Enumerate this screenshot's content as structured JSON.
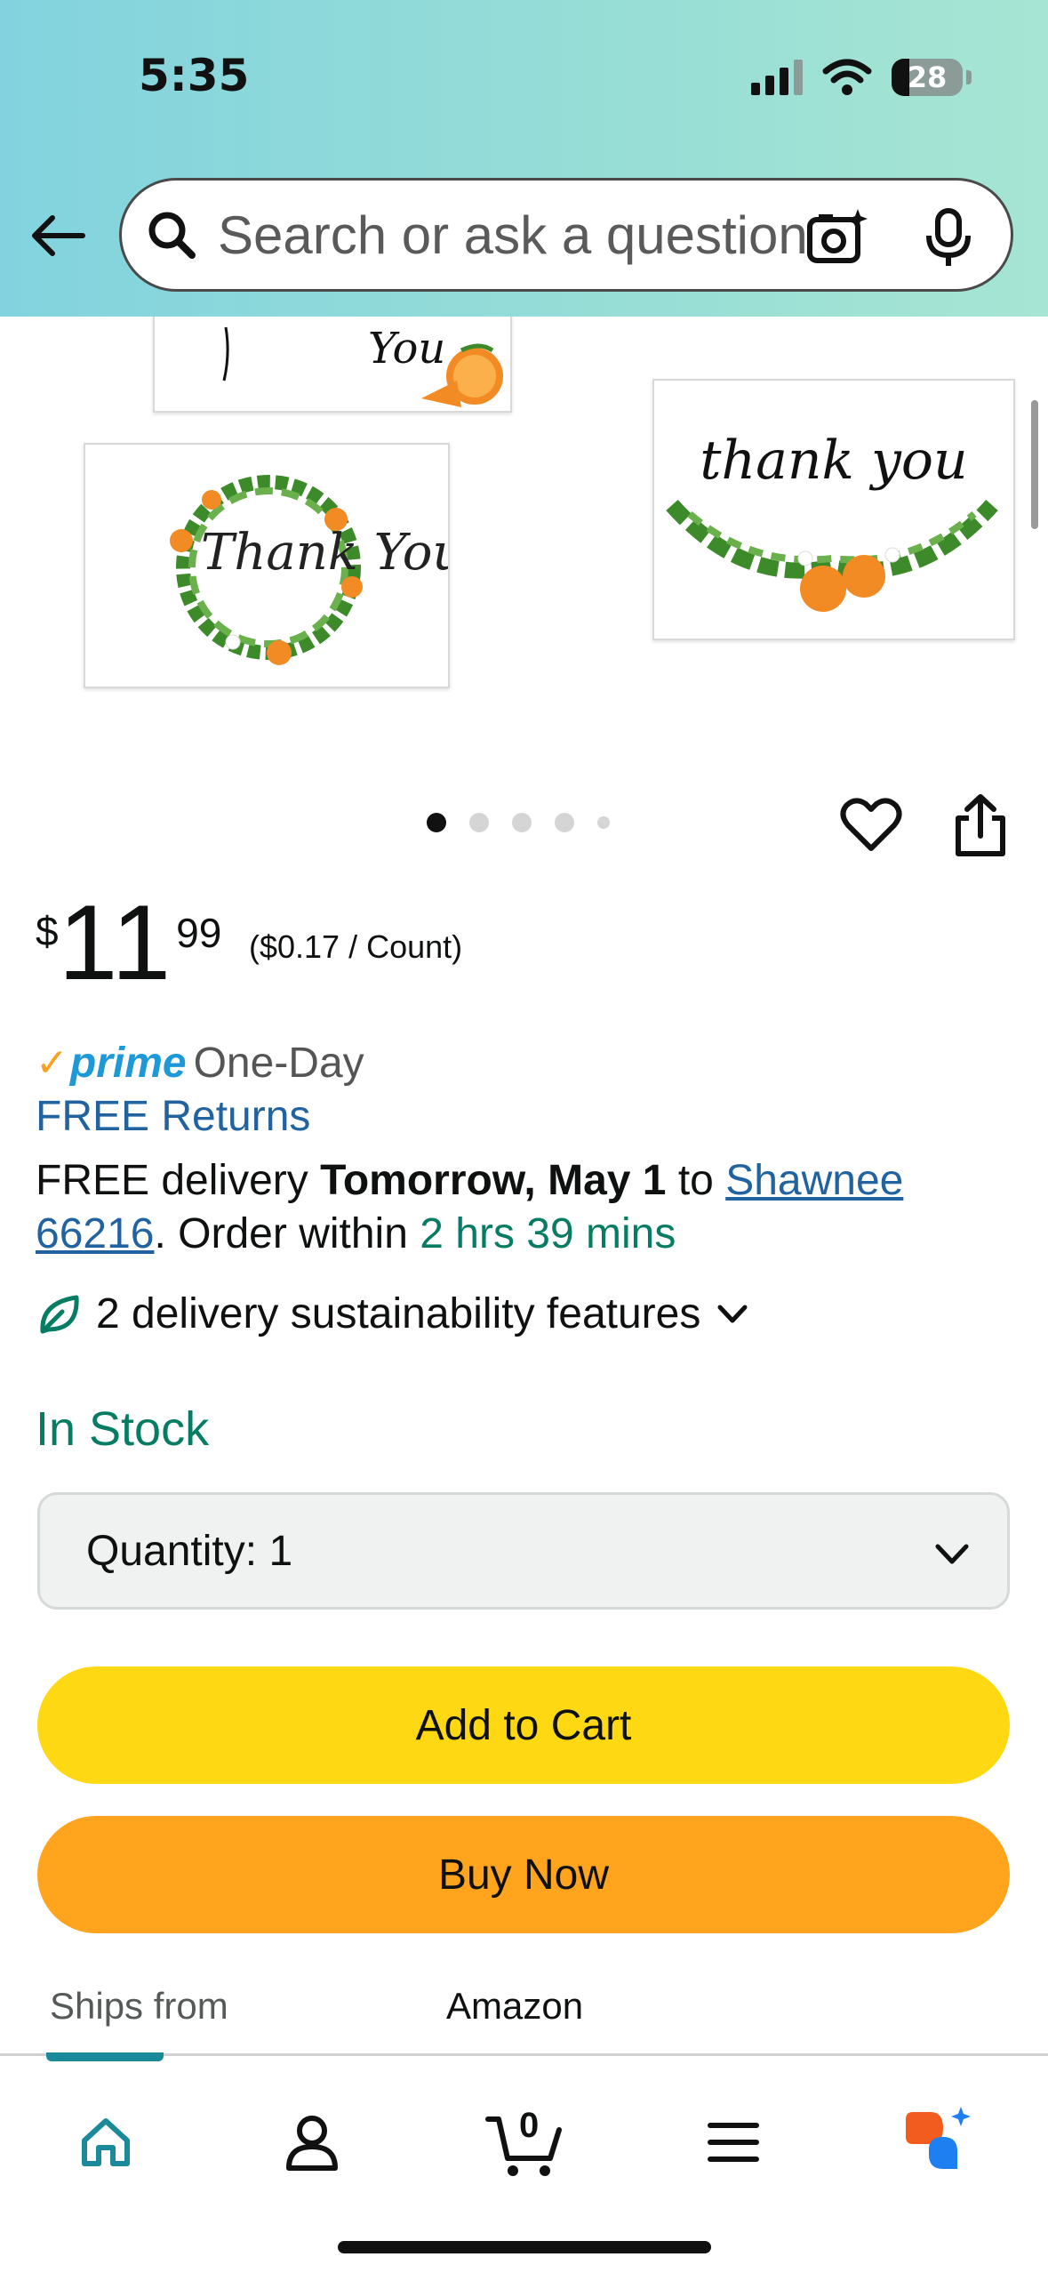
{
  "status": {
    "time": "5:35",
    "battery": "28"
  },
  "search": {
    "placeholder": "Search or ask a question"
  },
  "gallery": {
    "card_text_1": "You",
    "card_text_2": "thank you",
    "card_text_3": "Thank You",
    "image_count": 5,
    "active_index": 0
  },
  "price": {
    "symbol": "$",
    "whole": "11",
    "fraction": "99",
    "unit": "($0.17 / Count)"
  },
  "prime": {
    "word": "prime",
    "badge": "One-Day"
  },
  "returns": "FREE Returns",
  "delivery": {
    "prefix": "FREE delivery ",
    "date": "Tomorrow, May 1",
    "to": " to ",
    "location": "Shawnee 66216",
    "order_within": ". Order within ",
    "countdown": "2 hrs 39 mins"
  },
  "sustainability": "2 delivery sustainability features",
  "stock": "In Stock",
  "quantity": {
    "label": "Quantity:",
    "value": "1"
  },
  "buttons": {
    "add_to_cart": "Add to Cart",
    "buy_now": "Buy Now"
  },
  "ships": {
    "label": "Ships from",
    "value": "Amazon"
  },
  "cart_count": "0",
  "colors": {
    "accent": "#1a8a9b",
    "add_to_cart": "#ffd814",
    "buy_now": "#ffa41c",
    "link": "#2162a1",
    "green": "#067d62"
  },
  "icons": [
    "back-arrow-icon",
    "search-icon",
    "camera-icon",
    "mic-icon",
    "heart-icon",
    "share-icon",
    "leaf-icon",
    "chevron-down-icon",
    "home-icon",
    "account-icon",
    "cart-icon",
    "menu-icon",
    "rufus-icon"
  ]
}
